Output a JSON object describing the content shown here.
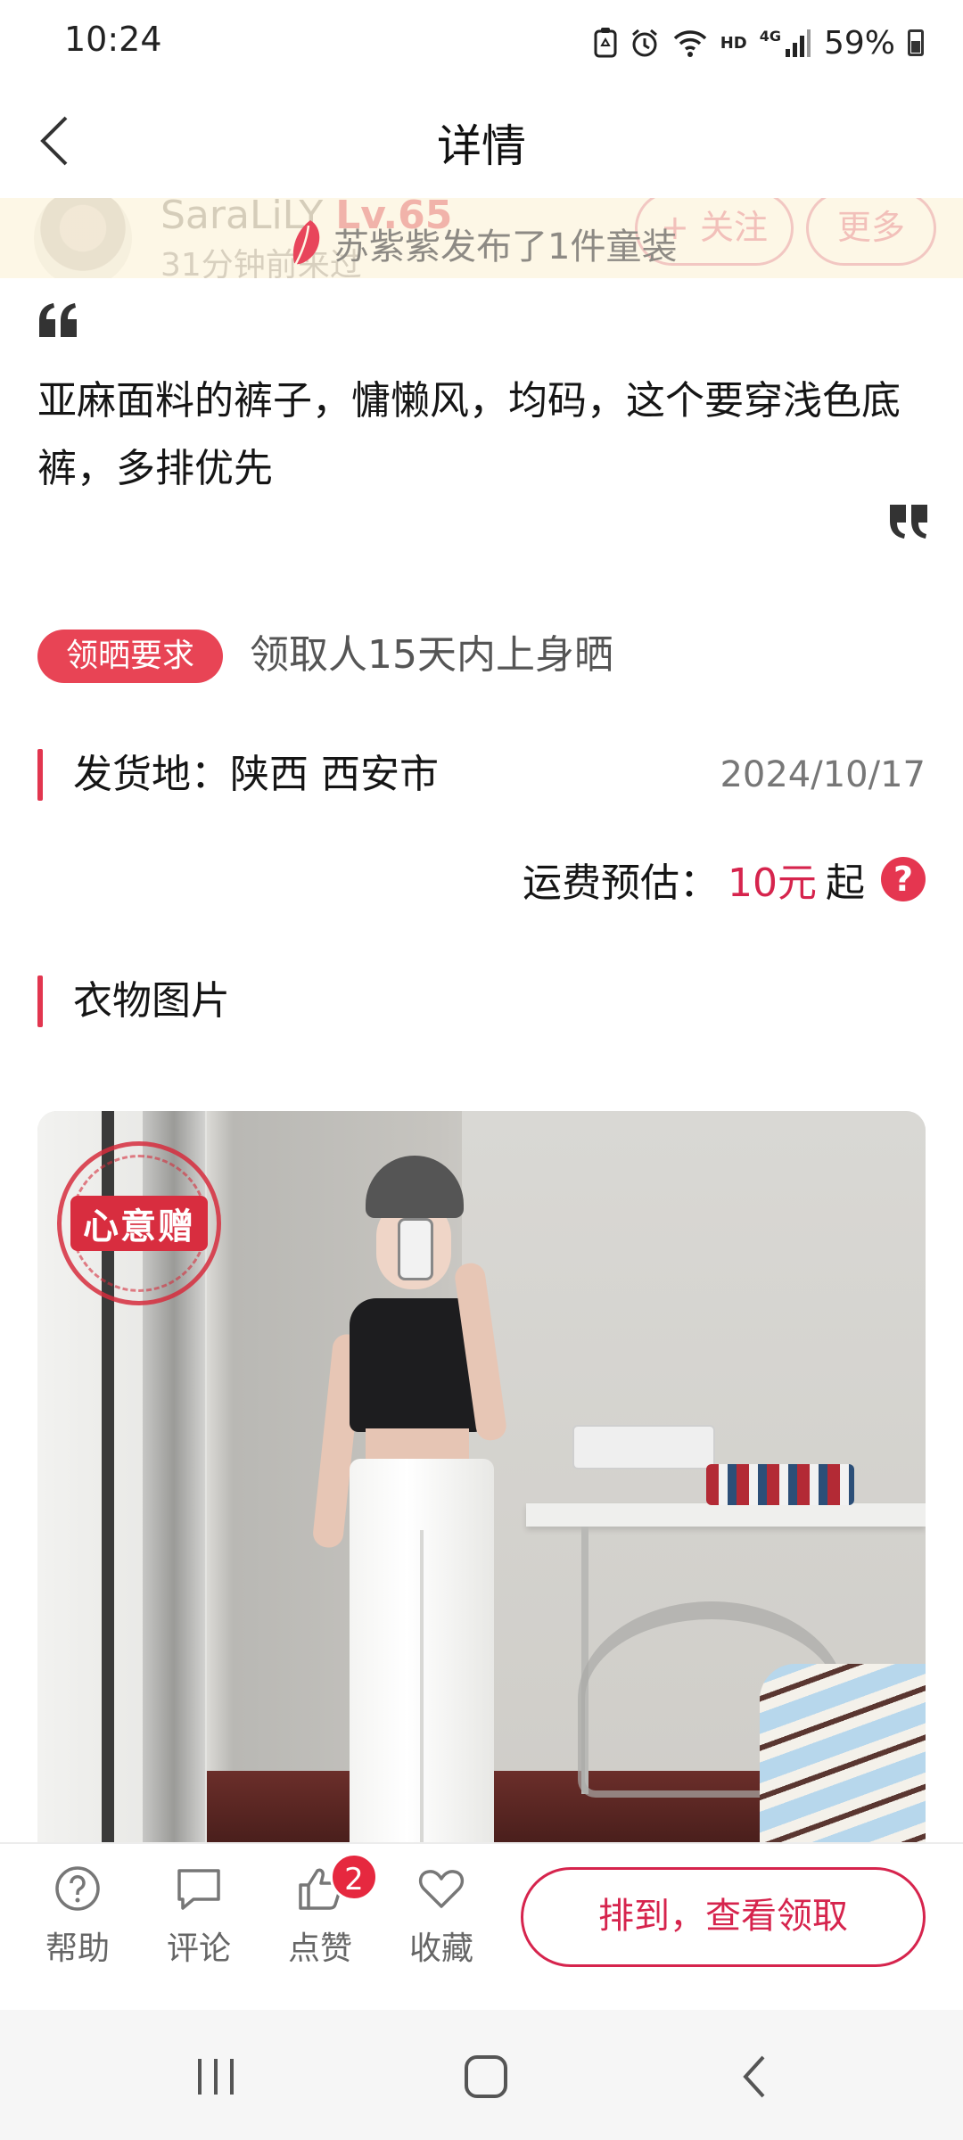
{
  "status_bar": {
    "time": "10:24",
    "network": "HD",
    "network_gen": "4G",
    "battery": "59%"
  },
  "header": {
    "title": "详情"
  },
  "banner": {
    "user_name": "SaraLiLY",
    "level": "Lv.65",
    "time_ago": "31分钟前来过",
    "follow_label": "+ 关注",
    "more_label": "更多",
    "notice": "苏紫紫发布了1件童装"
  },
  "description": "亚麻面料的裤子，慵懒风，均码，这个要穿浅色底裤，多排优先",
  "requirement": {
    "badge": "领晒要求",
    "text": "领取人15天内上身晒"
  },
  "shipping": {
    "label": "发货地：陕西 西安市",
    "date": "2024/10/17",
    "fee_label": "运费预估：",
    "fee_value": "10元",
    "fee_suffix": "起",
    "help_glyph": "?"
  },
  "photos": {
    "section_label": "衣物图片",
    "stamp_text": "心意赠"
  },
  "bottom_bar": {
    "help_label": "帮助",
    "comment_label": "评论",
    "like_label": "点赞",
    "like_count": "2",
    "favorite_label": "收藏",
    "claim_button": "排到，查看领取"
  },
  "colors": {
    "accent": "#e2364f",
    "primary_text": "#d6244d",
    "banner_bg": "#fdf7e6"
  }
}
